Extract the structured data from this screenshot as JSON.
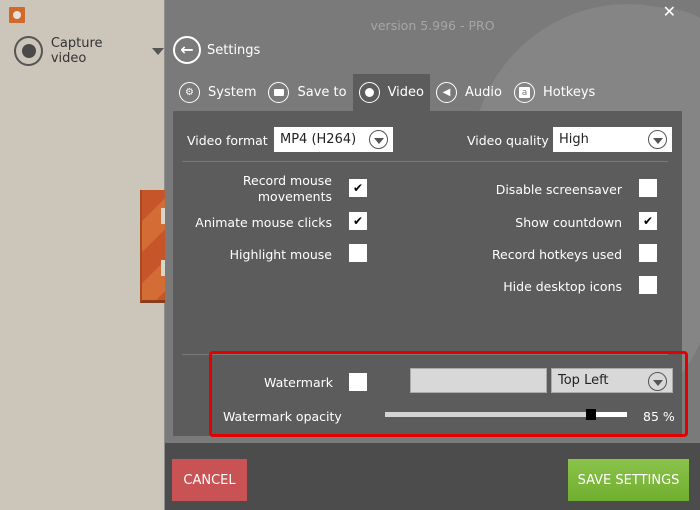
{
  "sidebar": {
    "app_icon": "screen-recorder-logo",
    "mode_label": "Capture video"
  },
  "header": {
    "version": "version 5.996 - PRO",
    "close_symbol": "✕",
    "back_label": "Settings",
    "back_symbol": "🡐"
  },
  "tabs": [
    {
      "label": "System",
      "icon": "gears-icon",
      "glyph": "⚙",
      "active": false
    },
    {
      "label": "Save to",
      "icon": "folder-icon",
      "glyph": "▬",
      "active": false
    },
    {
      "label": "Video",
      "icon": "record-icon",
      "glyph": "●",
      "active": true
    },
    {
      "label": "Audio",
      "icon": "speaker-icon",
      "glyph": "◀",
      "active": false
    },
    {
      "label": "Hotkeys",
      "icon": "keyboard-key-icon",
      "glyph": "a",
      "active": false
    }
  ],
  "video": {
    "format_label": "Video format",
    "format_value": "MP4 (H264)",
    "quality_label": "Video quality",
    "quality_value": "High",
    "options_left": [
      {
        "label": "Record mouse movements",
        "checked": true
      },
      {
        "label": "Animate mouse clicks",
        "checked": true
      },
      {
        "label": "Highlight mouse",
        "checked": false
      }
    ],
    "options_right": [
      {
        "label": "Disable screensaver",
        "checked": false
      },
      {
        "label": "Show countdown",
        "checked": true
      },
      {
        "label": "Record hotkeys used",
        "checked": false
      },
      {
        "label": "Hide desktop icons",
        "checked": false
      }
    ],
    "check_glyph": "✔"
  },
  "watermark": {
    "label": "Watermark",
    "checked": false,
    "text_value": "",
    "position_value": "Top Left",
    "opacity_label": "Watermark opacity",
    "opacity_percent": 85,
    "opacity_text": "85 %"
  },
  "footer": {
    "cancel_label": "CANCEL",
    "save_label": "SAVE SETTINGS"
  }
}
